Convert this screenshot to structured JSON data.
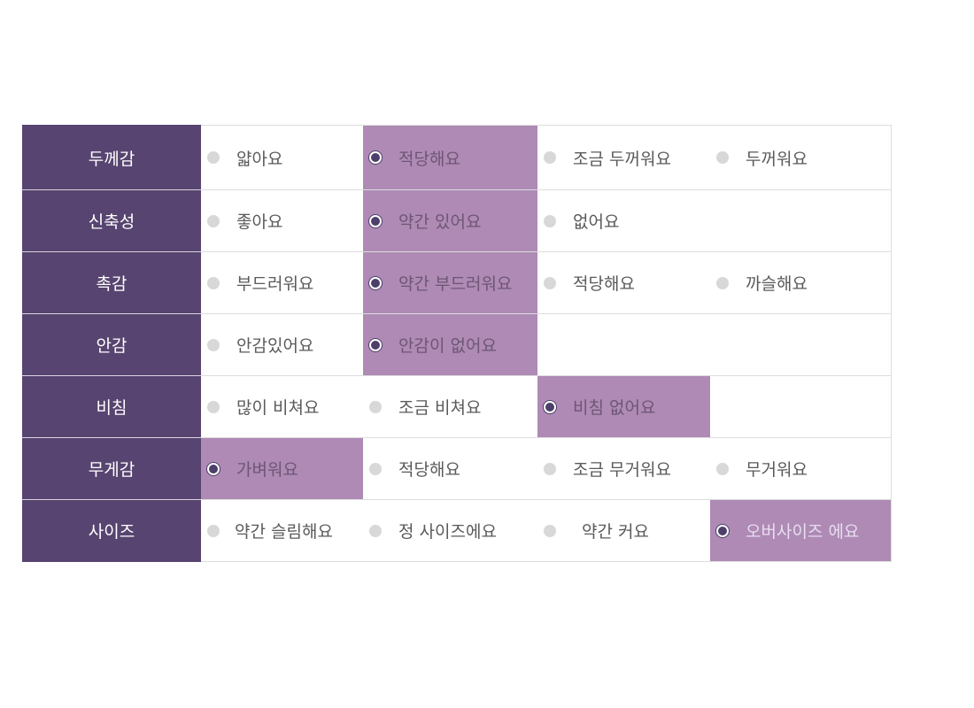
{
  "rows": [
    {
      "header": "두께감",
      "options": [
        "얇아요",
        "적당해요",
        "조금 두꺼워요",
        "두꺼워요"
      ],
      "selected": 1
    },
    {
      "header": "신축성",
      "options": [
        "좋아요",
        "약간 있어요",
        "없어요",
        ""
      ],
      "selected": 1
    },
    {
      "header": "촉감",
      "options": [
        "부드러워요",
        "약간 부드러워요",
        "적당해요",
        "까슬해요"
      ],
      "selected": 1
    },
    {
      "header": "안감",
      "options": [
        "안감있어요",
        "안감이 없어요",
        "",
        ""
      ],
      "selected": 1
    },
    {
      "header": "비침",
      "options": [
        "많이 비쳐요",
        "조금 비쳐요",
        "비침 없어요",
        ""
      ],
      "selected": 2
    },
    {
      "header": "무게감",
      "options": [
        "가벼워요",
        "적당해요",
        "조금  무거워요",
        "무거워요"
      ],
      "selected": 0
    },
    {
      "header": "사이즈",
      "options": [
        "약간 슬림해요",
        "정 사이즈에요",
        "약간 커요",
        "오버사이즈 에요"
      ],
      "selected": 3
    }
  ],
  "colors": {
    "header_bg": "#574470",
    "selected_bg": "#ae8ab5",
    "radio_off": "#d8d8d8",
    "radio_on": "#4d3f6a"
  }
}
